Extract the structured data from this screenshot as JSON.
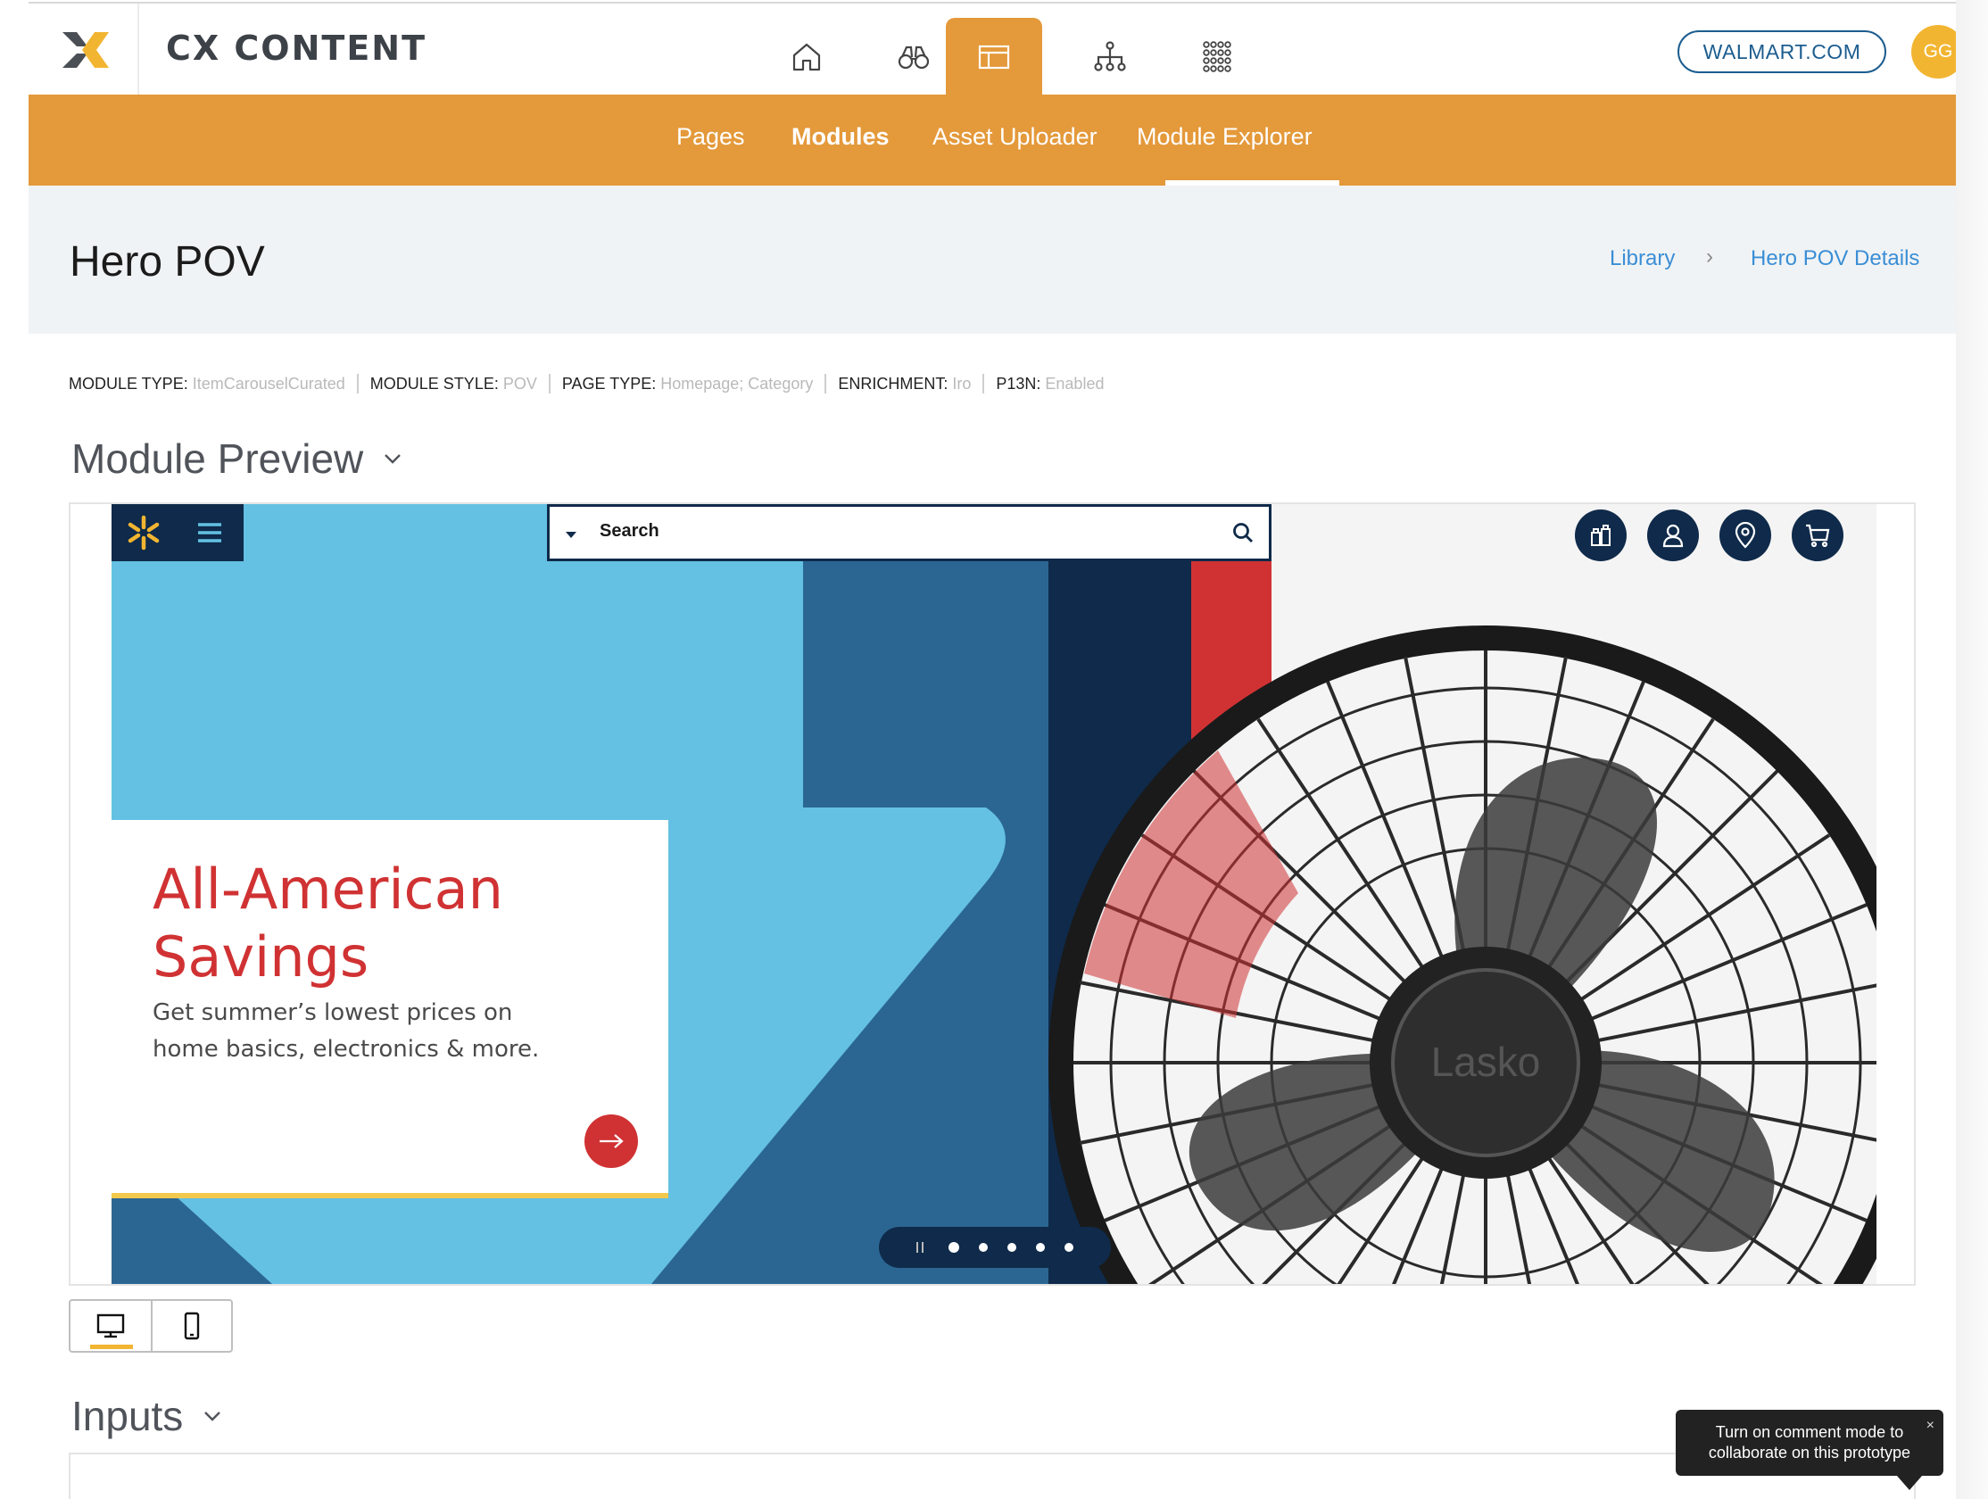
{
  "app": {
    "title": "CX CONTENT"
  },
  "topnav": {
    "icons": [
      "home-icon",
      "binoculars-icon",
      "layout-icon",
      "sitemap-icon",
      "apps-grid-icon"
    ],
    "active_index": 2
  },
  "site_selector": {
    "label": "WALMART.COM"
  },
  "user": {
    "initials": "GG"
  },
  "subnav": {
    "items": [
      {
        "label": "Pages"
      },
      {
        "label": "Modules"
      },
      {
        "label": "Asset Uploader"
      },
      {
        "label": "Module Explorer"
      }
    ],
    "active_label": "Module Explorer"
  },
  "page": {
    "title": "Hero POV",
    "breadcrumb": [
      {
        "label": "Library"
      },
      {
        "label": "Hero POV Details"
      }
    ],
    "breadcrumb_separator": "›"
  },
  "meta": {
    "module_type_key": "MODULE TYPE:",
    "module_type_val": "ItemCarouselCurated",
    "module_style_key": "MODULE STYLE:",
    "module_style_val": "POV",
    "page_type_key": "PAGE TYPE:",
    "page_type_val": "Homepage; Category",
    "enrichment_key": "ENRICHMENT:",
    "enrichment_val": "Iro",
    "p13n_key": "P13N:",
    "p13n_val": "Enabled"
  },
  "sections": {
    "preview": "Module Preview",
    "inputs": "Inputs"
  },
  "preview": {
    "search_placeholder": "Search",
    "promo_title": "All-American Savings",
    "promo_subtitle": "Get summer’s lowest prices on home basics, electronics & more.",
    "fan_brand": "Lasko",
    "pager_dots": 5,
    "pager_active": 0
  },
  "device_toggle": {
    "options": [
      "desktop-icon",
      "mobile-icon"
    ],
    "active": "desktop-icon"
  },
  "tooltip": {
    "text": "Turn on comment mode to collaborate on this prototype",
    "close": "×"
  },
  "colors": {
    "brand_orange": "#e4993a",
    "walmart_navy": "#0f2a4a",
    "walmart_blue": "#64c1e3",
    "promo_red": "#d03233",
    "link_blue": "#3a8ed6"
  }
}
